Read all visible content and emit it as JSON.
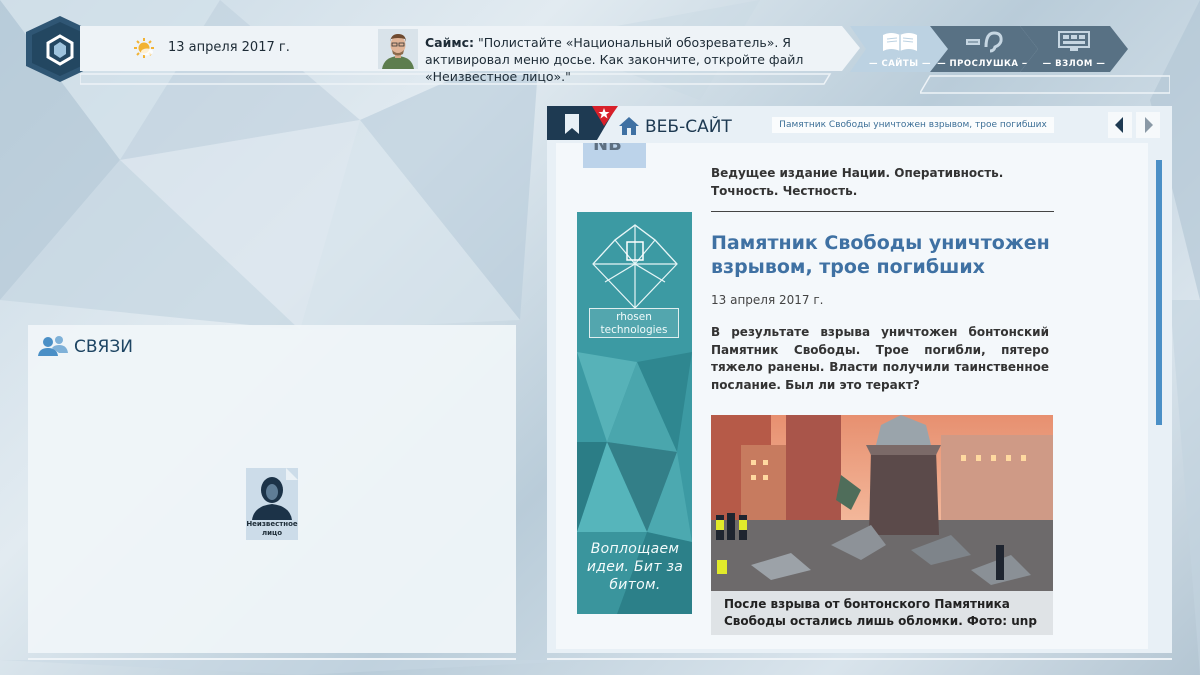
{
  "header": {
    "date": "13 апреля 2017 г.",
    "message_author": "Саймс:",
    "message_text": " \"Полистайте «Национальный обозреватель». Я активировал меню досье. Как закончите, откройте файл «Неизвестное лицо».\""
  },
  "tabs": [
    {
      "label": "— САЙТЫ —",
      "icon": "book-icon",
      "active": true
    },
    {
      "label": "— ПРОСЛУШКА —",
      "icon": "ear-icon",
      "active": false
    },
    {
      "label": "— ВЗЛОМ —",
      "icon": "monitor-icon",
      "active": false
    }
  ],
  "contacts": {
    "title": "СВЯЗИ",
    "cards": [
      {
        "label": "Неизвестное лицо"
      }
    ]
  },
  "website": {
    "panel_title": "ВЕБ-САЙТ",
    "url": "Памятник Свободы уничтожен взрывом, трое погибших",
    "site_logo_partial": "NB",
    "tagline": "Ведущее издание Нации. Оперативность. Точность. Честность.",
    "article": {
      "headline": "Памятник Свободы уничтожен взрывом, трое погибших",
      "date": "13 апреля 2017 г.",
      "lead": "В результате взрыва уничтожен бонтонский Памятник Свободы. Трое погибли, пятеро тяжело ранены. Власти получили таинственное послание. Был ли это теракт?",
      "photo_caption": "После взрыва от бонтонского Памятника Свободы остались лишь обломки. Фото: unp"
    },
    "ad": {
      "brand_line1": "rhosen",
      "brand_line2": "technologies",
      "slogan": "Воплощаем идеи. Бит за битом."
    }
  },
  "colors": {
    "accent": "#3f71a3",
    "dark": "#1e3a52",
    "flag_red": "#d8202a"
  }
}
